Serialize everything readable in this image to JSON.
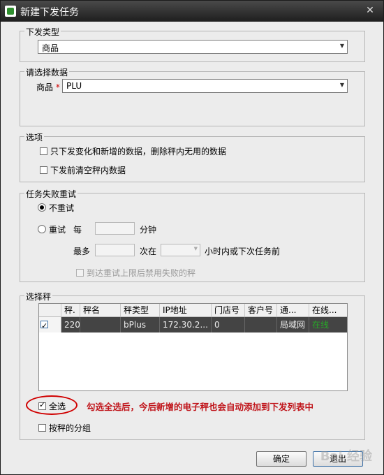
{
  "window": {
    "title": "新建下发任务",
    "close_glyph": "✕"
  },
  "dispatch_type": {
    "legend": "下发类型",
    "value": "商品"
  },
  "select_data": {
    "legend": "请选择数据",
    "label": "商品",
    "required_mark": "*",
    "value": "PLU"
  },
  "options": {
    "legend": "选项",
    "only_changed": "只下发变化和新增的数据，删除秤内无用的数据",
    "clear_before": "下发前清空秤内数据"
  },
  "retry": {
    "legend": "任务失败重试",
    "no_retry": "不重试",
    "retry": "重试",
    "every": "每",
    "minutes": "分钟",
    "at_most": "最多",
    "times_in": "次在",
    "hours_suffix": "小时内或下次任务前",
    "disable_failed": "到达重试上限后禁用失败的秤"
  },
  "scales": {
    "legend": "选择秤",
    "columns": [
      "秤.",
      "秤名",
      "秤类型",
      "IP地址",
      "门店号",
      "客户号",
      "通...",
      "在线..."
    ],
    "rows": [
      {
        "num": "220",
        "name": "",
        "type": "bPlus",
        "ip": "172.30.2...",
        "store": "0",
        "customer": "",
        "conn": "局域网",
        "online": "在线"
      }
    ],
    "select_all": "全选",
    "group_by": "按秤的分组"
  },
  "annotation": "勾选全选后，今后新增的电子秤也会自动添加到下发列表中",
  "buttons": {
    "ok": "确定",
    "exit": "退出"
  },
  "watermark": "Bai 经验",
  "colors": {
    "online": "#27a627",
    "annotation": "#c0141a"
  }
}
